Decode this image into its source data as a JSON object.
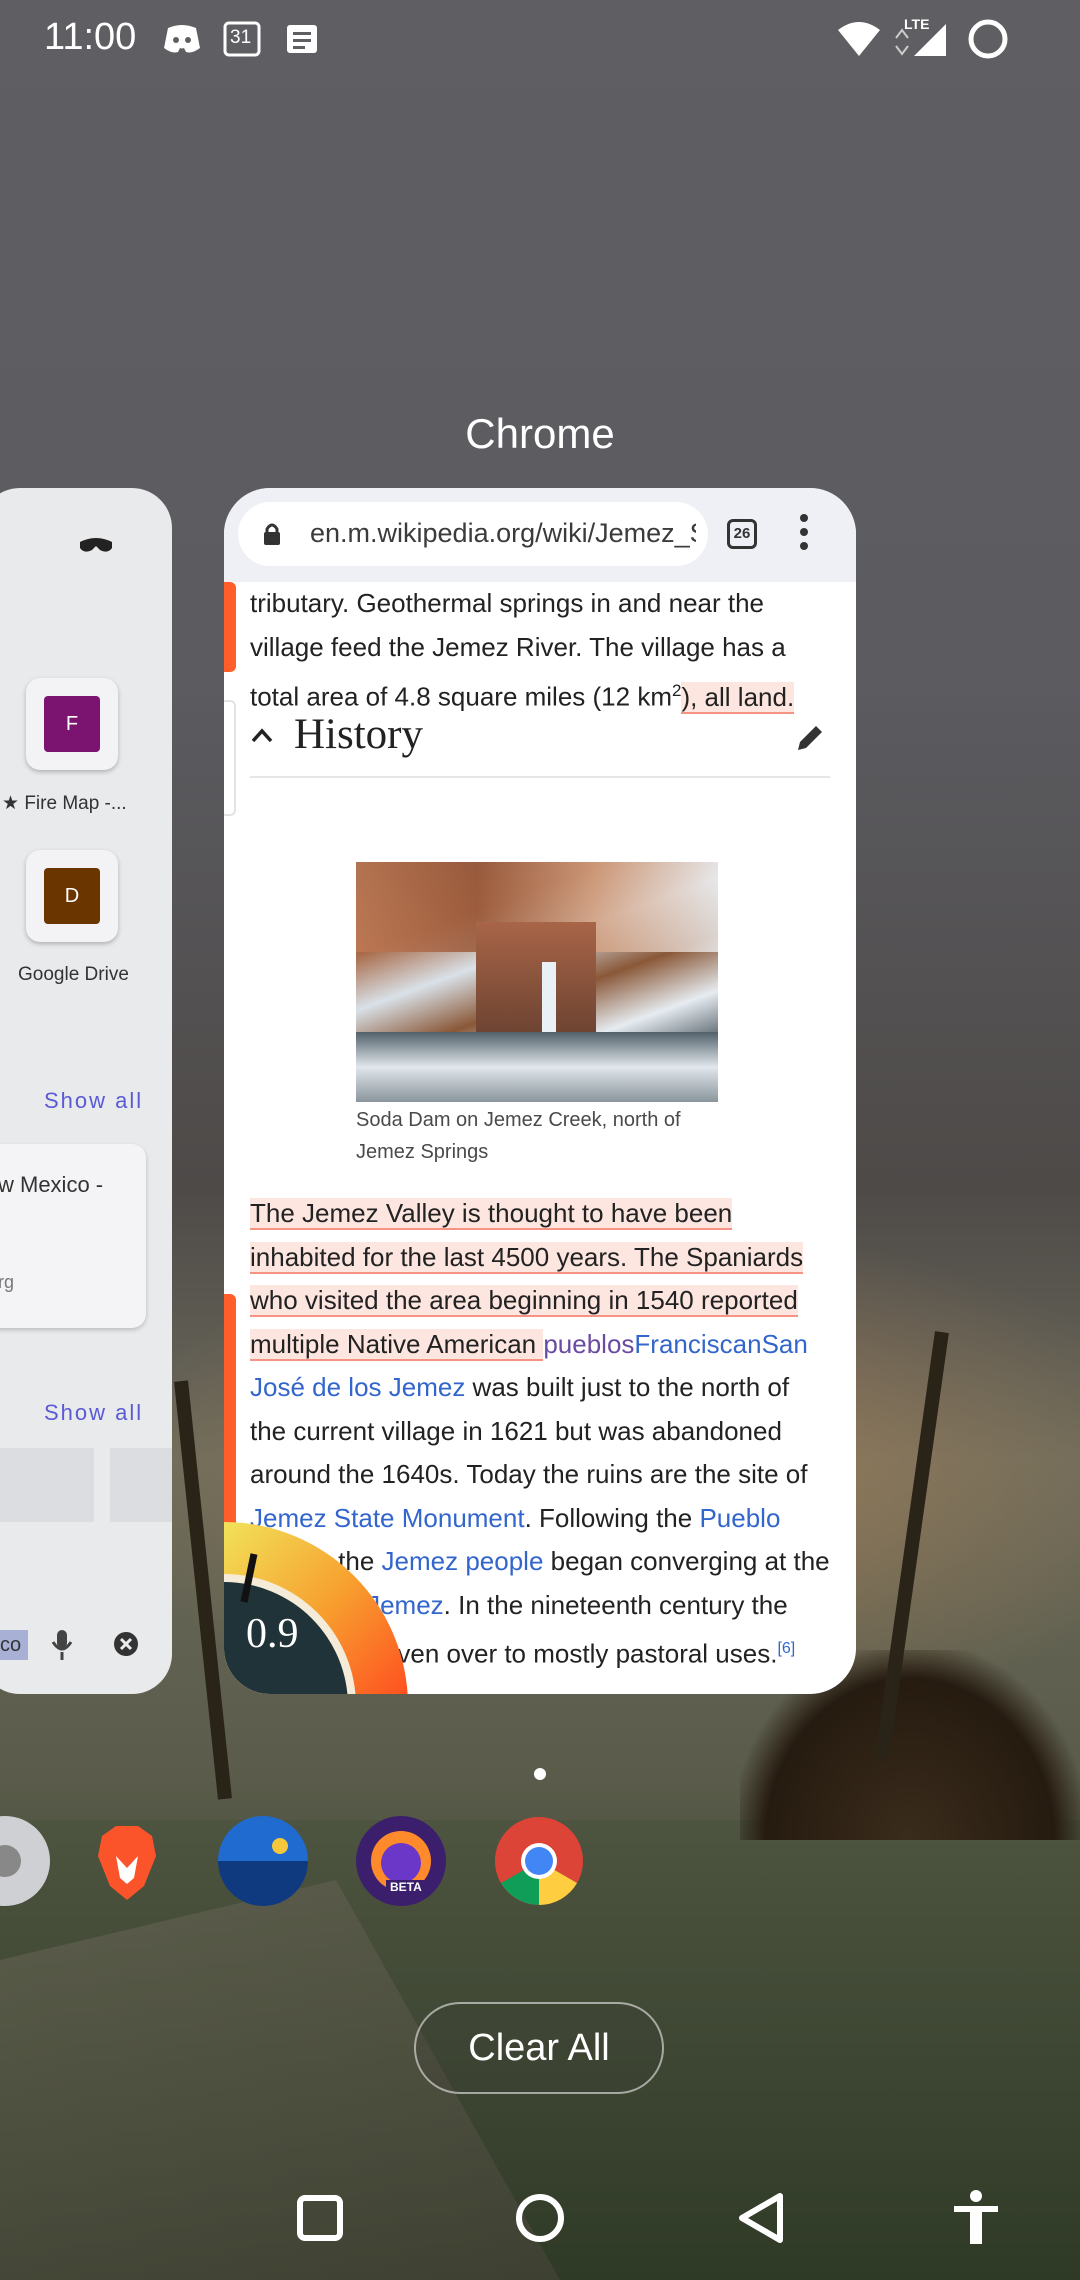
{
  "status_bar": {
    "time": "11:00",
    "notification_icons": [
      "discord-icon",
      "calendar-icon",
      "news-icon"
    ],
    "calendar_day": "31",
    "network": "LTE",
    "right_icons": [
      "wifi-icon",
      "lte-signal-icon",
      "battery-circle-icon"
    ]
  },
  "recents": {
    "app_label": "Chrome",
    "left_card": {
      "tiles": [
        {
          "letter": "F",
          "label": "Fire Map -...",
          "color": "#7b1470"
        },
        {
          "letter": "D",
          "label": "Google Drive",
          "color": "#6b3500"
        }
      ],
      "show_all_1": "Show all",
      "show_all_2": "Show all",
      "tab_title": "w Mexico -",
      "tab_domain": "rg",
      "search_text": "co"
    }
  },
  "chrome_card": {
    "url": "en.m.wikipedia.org/wiki/Jemez_Springs",
    "tab_count": "26",
    "article": {
      "para1": {
        "text": "tributary. Geothermal springs in and near the village feed the Jemez River. The village has a total area of 4.8 square miles (12 km",
        "sup": "2",
        "highlight": "), all land."
      },
      "section_title": "History",
      "image_caption": "Soda Dam on Jemez Creek, north of Jemez Springs",
      "para2": {
        "highlight": "The Jemez Valley is thought to have been inhabited for the last 4500 years. The Spaniards who visited the area beginning in 1540 reported multiple Native American ",
        "link_pueblos": "pueblos",
        "link_franciscan": "Franciscan",
        "link_san_jose": "San José de los Jemez",
        "text1": " was built just to the north of the current village in 1621 but was abandoned around the 1640s. Today the ruins are the site of ",
        "link_monument": "Jemez State Monument",
        "text2": ". Following the ",
        "link_revolt": "Pueblo Revolt",
        "text3": ", the ",
        "link_jemez_people": "Jemez people",
        "text4": " began converging at the ",
        "link_pueblo_jemez": "Pueblo of Jemez",
        "text5": ". In the nineteenth century the valley was given over to mostly pastoral uses.",
        "ref": "[6]"
      }
    },
    "gauge_value": "0.9"
  },
  "dock": {
    "apps": [
      "settings-icon",
      "brave-icon",
      "weather-icon",
      "firefox-beta-icon",
      "chrome-icon"
    ],
    "beta_label": "BETA"
  },
  "clear_all_label": "Clear All",
  "nav_bar": {
    "buttons": [
      "recents",
      "home",
      "back",
      "accessibility"
    ]
  }
}
